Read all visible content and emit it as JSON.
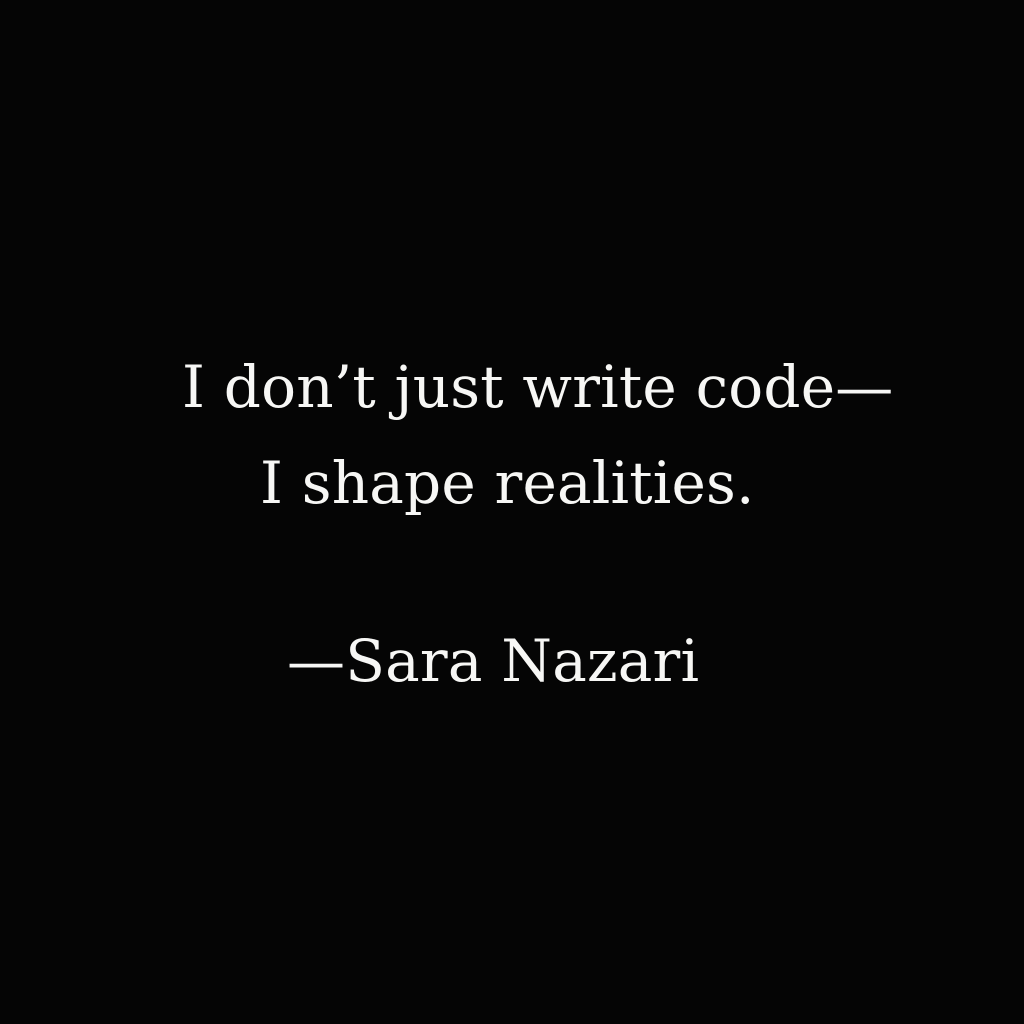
{
  "quote": {
    "line_1": "I don’t just write code—",
    "line_2": "I shape realities."
  },
  "attribution": {
    "text": "—Sara Nazari"
  },
  "colors": {
    "background": "#050505",
    "text": "#f7f7f5"
  }
}
